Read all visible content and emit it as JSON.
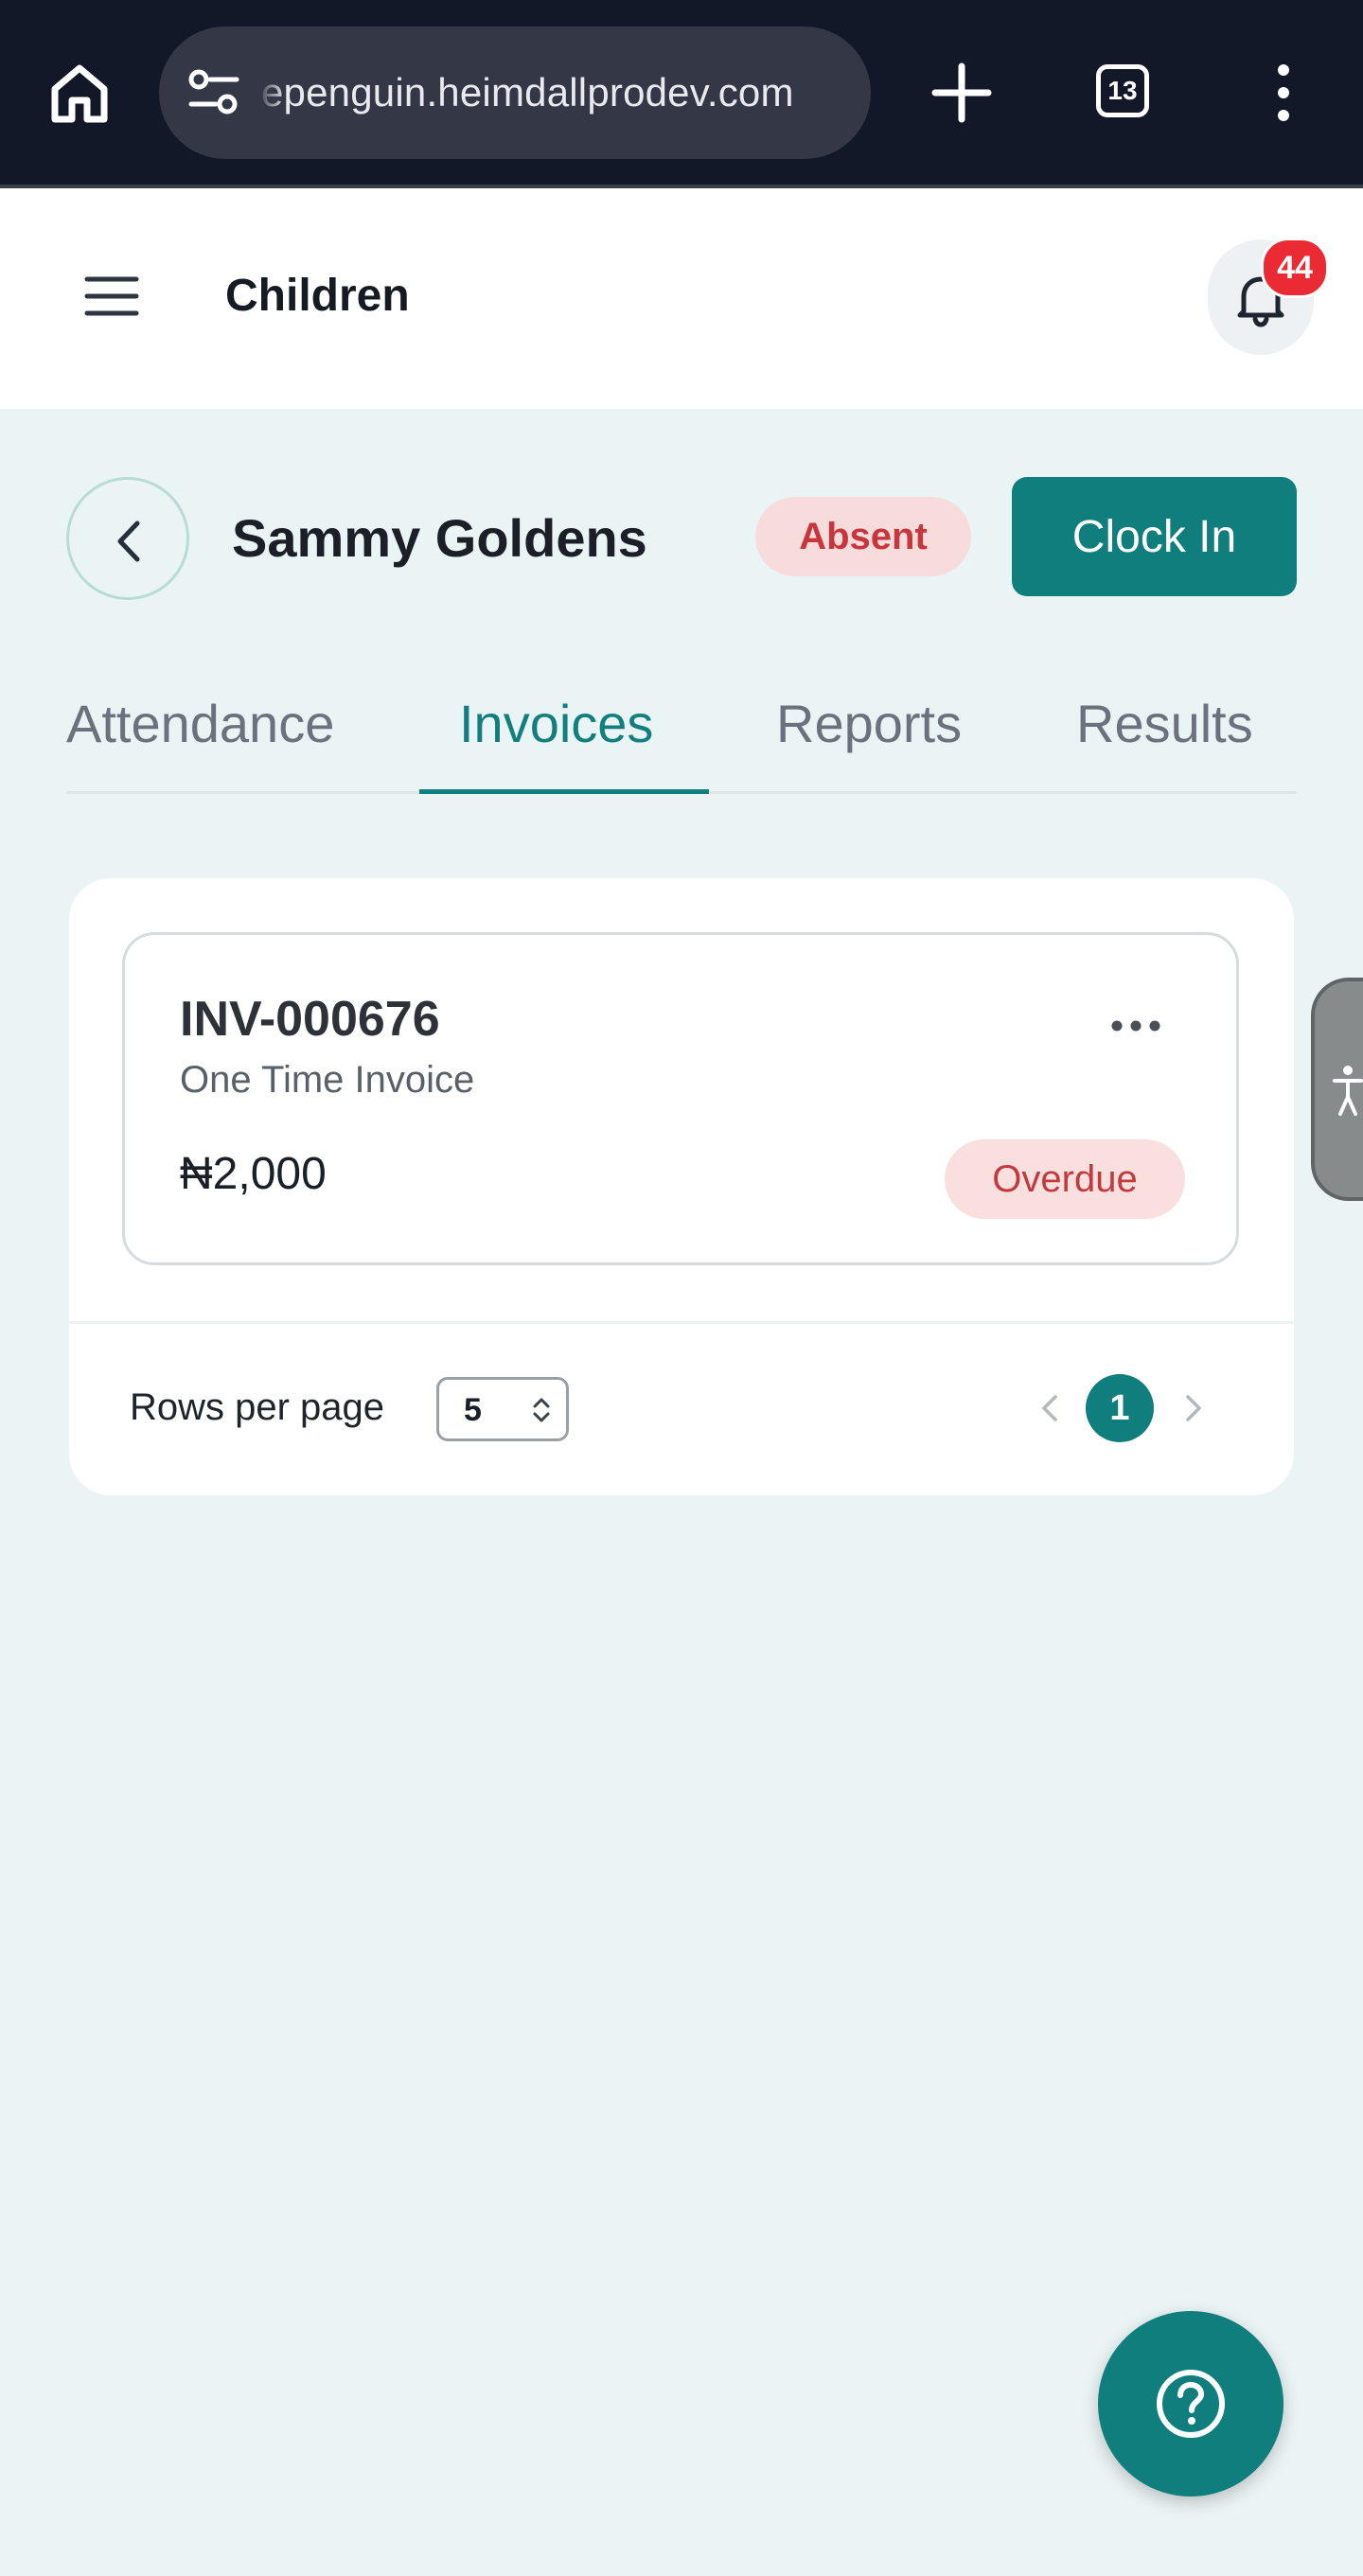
{
  "browser": {
    "url_text": "epenguin.heimdallprodev.com",
    "tab_count": "13"
  },
  "header": {
    "title": "Children",
    "notification_count": "44"
  },
  "child": {
    "name": "Sammy Goldens",
    "status": "Absent",
    "clock_in_label": "Clock In"
  },
  "tabs": [
    {
      "label": "Attendance",
      "active": false
    },
    {
      "label": "Invoices",
      "active": true
    },
    {
      "label": "Reports",
      "active": false
    },
    {
      "label": "Results",
      "active": false
    }
  ],
  "invoices": [
    {
      "number": "INV-000676",
      "type": "One Time Invoice",
      "amount": "₦2,000",
      "status": "Overdue"
    }
  ],
  "pagination": {
    "rows_per_page_label": "Rows per page",
    "rows_per_page_value": "5",
    "current_page": "1"
  },
  "colors": {
    "primary": "#0f7e7d",
    "danger": "#c7363c",
    "danger_bg": "#f8dcdc",
    "background": "#ebf4f5",
    "chrome": "#131828"
  },
  "icons": {
    "home": "home-icon",
    "tune": "site-settings-icon",
    "new_tab": "plus-icon",
    "menu": "kebab-icon",
    "hamburger": "hamburger-icon",
    "notifications": "bell-icon",
    "back": "chevron-left-icon",
    "more": "more-horizontal-icon",
    "accessibility": "accessibility-icon",
    "help": "help-circle-icon"
  }
}
